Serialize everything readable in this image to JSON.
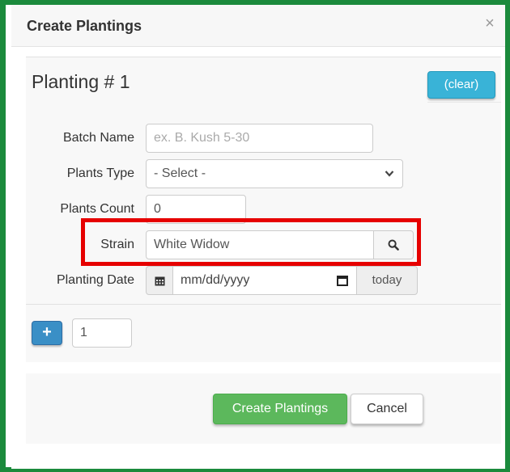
{
  "dialog": {
    "title": "Create Plantings",
    "close_glyph": "×"
  },
  "planting": {
    "heading": "Planting # 1",
    "clear_label": "(clear)"
  },
  "form": {
    "batch_name": {
      "label": "Batch Name",
      "value": "",
      "placeholder": "ex. B. Kush 5-30"
    },
    "plants_type": {
      "label": "Plants Type",
      "selected": "- Select -"
    },
    "plants_count": {
      "label": "Plants Count",
      "value": "0"
    },
    "strain": {
      "label": "Strain",
      "value": "White Widow"
    },
    "planting_date": {
      "label": "Planting Date",
      "placeholder": "mm/dd/yyyy",
      "today_label": "today"
    }
  },
  "add_row": {
    "plus_label": "+",
    "count_value": "1"
  },
  "footer": {
    "create_label": "Create Plantings",
    "cancel_label": "Cancel"
  },
  "icons": {
    "close": "close-icon",
    "search": "search-icon",
    "calendar": "calendar-icon",
    "chevron": "chevron-down-icon"
  },
  "colors": {
    "frame_border": "#1b8a3c",
    "highlight": "#e60000",
    "info_button": "#39b3d7",
    "primary_button": "#3a8fc6",
    "success_button": "#5cb85c"
  }
}
